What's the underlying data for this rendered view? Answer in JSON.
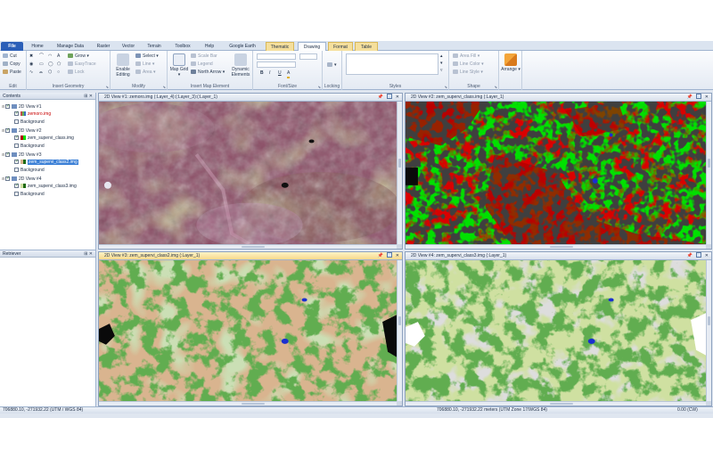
{
  "ribbon_tabs": [
    "File",
    "Home",
    "Manage Data",
    "Raster",
    "Vector",
    "Terrain",
    "Toolbox",
    "Help",
    "Google Earth",
    "Thematic",
    "Drawing",
    "Format",
    "Table"
  ],
  "groups": {
    "edit": {
      "label": "Edit",
      "cut": "Cut",
      "copy": "Copy",
      "paste": "Paste"
    },
    "insert_geometry": {
      "label": "Insert Geometry",
      "grow": "Grow",
      "easytrace": "EasyTrace",
      "lock": "Lock"
    },
    "modify": {
      "label": "Modify",
      "enable_editing": "Enable Editing",
      "select": "Select",
      "line": "Line",
      "area": "Area"
    },
    "insert_map_element": {
      "label": "Insert Map Element",
      "map_grid": "Map Grid",
      "scale_bar": "Scale Bar",
      "legend": "Legend",
      "north_arrow": "North Arrow",
      "dynamic_elements": "Dynamic Elements"
    },
    "font_size": {
      "label": "Font/Size",
      "bold": "B",
      "italic": "I",
      "underline": "U",
      "font_color": "A"
    },
    "locking": {
      "label": "Locking"
    },
    "styles": {
      "label": "Styles"
    },
    "shape": {
      "label": "Shape",
      "area_fill": "Area Fill",
      "line_color": "Line Color",
      "line_style": "Line Style"
    },
    "arrange": {
      "label": "Arrange"
    }
  },
  "contents_panel": {
    "title": "Contents",
    "items": [
      {
        "label": "2D View #1",
        "level": 0
      },
      {
        "label": "zemoro.img",
        "level": 1,
        "style": "red"
      },
      {
        "label": "Background",
        "level": 1
      },
      {
        "label": "2D View #2",
        "level": 0
      },
      {
        "label": "zem_supervi_class.img",
        "level": 1
      },
      {
        "label": "Background",
        "level": 1
      },
      {
        "label": "2D View #3",
        "level": 0
      },
      {
        "label": "zem_supervi_class2.img",
        "level": 1,
        "style": "highlight"
      },
      {
        "label": "Background",
        "level": 1
      },
      {
        "label": "2D View #4",
        "level": 0
      },
      {
        "label": "zem_supervi_class3.img",
        "level": 1
      },
      {
        "label": "Background",
        "level": 1
      }
    ]
  },
  "retriever_panel": {
    "title": "Retriever"
  },
  "views": [
    {
      "title": "2D View #1: zemoro.img (:Layer_4):(:Layer_3):(:Layer_1)",
      "map": "rgb"
    },
    {
      "title": "2D View #2: zem_supervi_class.img (:Layer_1)",
      "map": "class_red_green"
    },
    {
      "title": "2D View #3: zem_supervi_class2.img (:Layer_1)",
      "map": "class_tan"
    },
    {
      "title": "2D View #4: zem_supervi_class3.img (:Layer_1)",
      "map": "class_pale"
    }
  ],
  "status": {
    "left_coords": "706880.10, -271932.22",
    "left_units": "(UTM / WGS 84)",
    "right_coords": "706880.10, -271932.22 meters (UTM Zone 17/WGS 84)",
    "rotation": "0.00 (CW)"
  },
  "colors": {
    "file_tab": "#2b5fb8",
    "contextual_tab": "#f5df9c",
    "active_view_header": "#f6d98b",
    "selection": "#3a7fd6",
    "class_red": "#b30000",
    "class_green": "#00e000",
    "class_tan": "#d9b48f",
    "class_dark_green": "#1e6b14",
    "class_water": "#1a2fd0",
    "class_pale": "#cfe0a1"
  }
}
